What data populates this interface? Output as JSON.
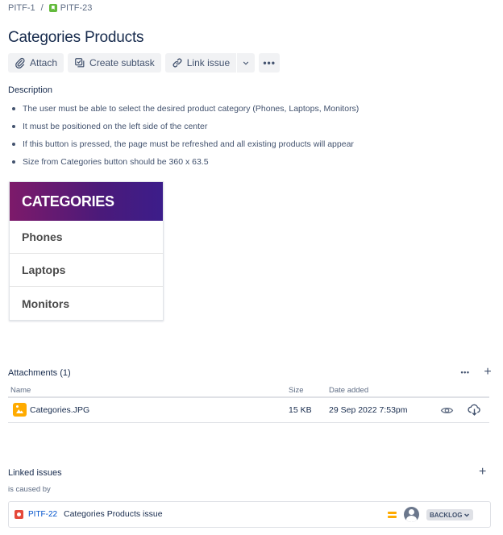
{
  "breadcrumb": {
    "parent": "PITF-1",
    "separator": "/",
    "current": "PITF-23"
  },
  "issue": {
    "title": "Categories Products"
  },
  "toolbar": {
    "attach_label": "Attach",
    "subtask_label": "Create subtask",
    "link_label": "Link issue",
    "more_label": "•••"
  },
  "description": {
    "label": "Description",
    "bullets": [
      "The user must be able to select the desired product category (Phones, Laptops, Monitors)",
      "It must be positioned on the left side of the center",
      "If this button is pressed, the page must be refreshed and all existing products will appear",
      "Size from Categories button should be 360 x 63.5"
    ]
  },
  "preview": {
    "header": "CATEGORIES",
    "items": [
      "Phones",
      "Laptops",
      "Monitors"
    ],
    "header_gradient": [
      "#7d1a6a",
      "#3c1d8a"
    ]
  },
  "attachments": {
    "title": "Attachments (1)",
    "more_label": "•••",
    "add_label": "+",
    "columns": {
      "name": "Name",
      "size": "Size",
      "date": "Date added"
    },
    "files": [
      {
        "name": "Categories.JPG",
        "size": "15 KB",
        "date": "29 Sep 2022 7:53pm"
      }
    ]
  },
  "linked_issues": {
    "title": "Linked issues",
    "add_label": "+",
    "relation": "is caused by",
    "items": [
      {
        "key": "PITF-22",
        "summary": "Categories Products issue",
        "status": "BACKLOG",
        "priority": "medium"
      }
    ]
  },
  "colors": {
    "link": "#0052cc",
    "text": "#172b4d",
    "subtle": "#5e6c84",
    "priority_medium": "#ffab00",
    "bug": "#e5493a",
    "story": "#63ba3c"
  }
}
